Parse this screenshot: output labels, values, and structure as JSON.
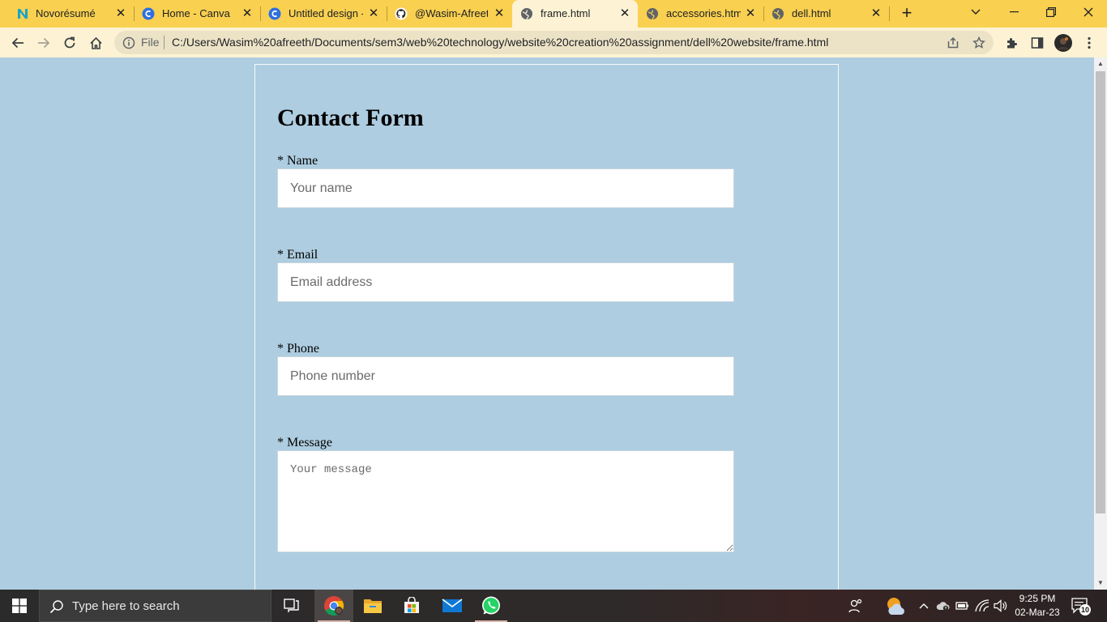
{
  "browser": {
    "tabs": [
      {
        "title": "Novorésumé",
        "icon": "novoresume-icon",
        "active": false
      },
      {
        "title": "Home - Canva",
        "icon": "canva-icon",
        "active": false
      },
      {
        "title": "Untitled design -",
        "icon": "canva-icon",
        "active": false
      },
      {
        "title": "@Wasim-Afreeth",
        "icon": "github-icon",
        "active": false
      },
      {
        "title": "frame.html",
        "icon": "globe-icon",
        "active": true
      },
      {
        "title": "accessories.html",
        "icon": "globe-icon",
        "active": false
      },
      {
        "title": "dell.html",
        "icon": "globe-icon",
        "active": false
      }
    ],
    "new_tab": "+",
    "omnibox": {
      "scheme_label": "File",
      "url": "C:/Users/Wasim%20afreeth/Documents/sem3/web%20technology/website%20creation%20assignment/dell%20website/frame.html"
    },
    "colors": {
      "tabstrip": "#f9d050",
      "toolbar": "#fdf3d4",
      "page_bg": "#aecde0"
    }
  },
  "page": {
    "form_title": "Contact Form",
    "fields": [
      {
        "label": "* Name",
        "placeholder": "Your name",
        "value": ""
      },
      {
        "label": "* Email",
        "placeholder": "Email address",
        "value": ""
      },
      {
        "label": "* Phone",
        "placeholder": "Phone number",
        "value": ""
      },
      {
        "label": "* Message",
        "placeholder": "Your message",
        "value": ""
      }
    ]
  },
  "taskbar": {
    "search_placeholder": "Type here to search",
    "apps": [
      "task-view-icon",
      "chrome-icon",
      "file-explorer-icon",
      "microsoft-store-icon",
      "mail-icon",
      "whatsapp-icon"
    ],
    "clock": {
      "time": "9:25 PM",
      "date": "02-Mar-23"
    },
    "notification_count": "10"
  }
}
